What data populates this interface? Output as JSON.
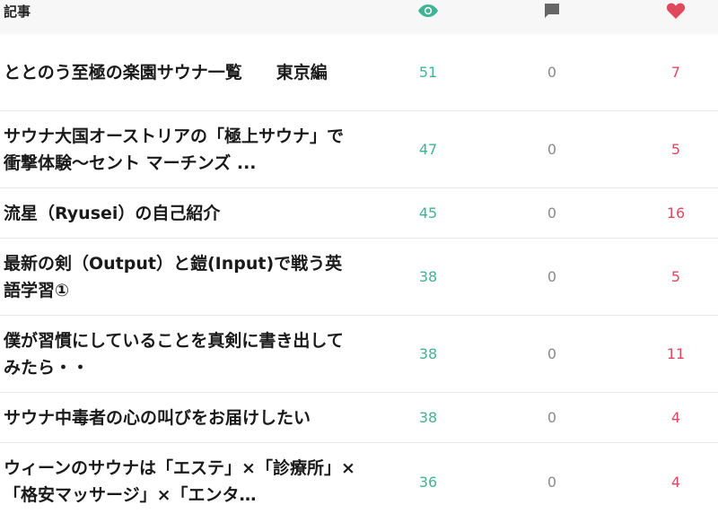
{
  "header": {
    "article_label": "記事",
    "views_icon": "eye-icon",
    "comments_icon": "comment-icon",
    "likes_icon": "heart-icon"
  },
  "colors": {
    "views": "#41b395",
    "comments": "#8a8a8a",
    "likes": "#e0485e"
  },
  "rows": [
    {
      "title": "ととのう至極の楽園サウナ一覧　　東京編",
      "views": "51",
      "comments": "0",
      "likes": "7"
    },
    {
      "title": "サウナ大国オーストリアの「極上サウナ」で衝撃体験～セント マーチンズ ...",
      "views": "47",
      "comments": "0",
      "likes": "5"
    },
    {
      "title": "流星（Ryusei）の自己紹介",
      "views": "45",
      "comments": "0",
      "likes": "16"
    },
    {
      "title": "最新の剣（Output）と鎧(Input)で戦う英語学習①",
      "views": "38",
      "comments": "0",
      "likes": "5"
    },
    {
      "title": "僕が習慣にしていることを真剣に書き出してみたら・・",
      "views": "38",
      "comments": "0",
      "likes": "11"
    },
    {
      "title": "サウナ中毒者の心の叫びをお届けしたい",
      "views": "38",
      "comments": "0",
      "likes": "4"
    },
    {
      "title": "ウィーンのサウナは「エステ」×「診療所」×「格安マッサージ」×「エンタ…",
      "views": "36",
      "comments": "0",
      "likes": "4"
    }
  ]
}
